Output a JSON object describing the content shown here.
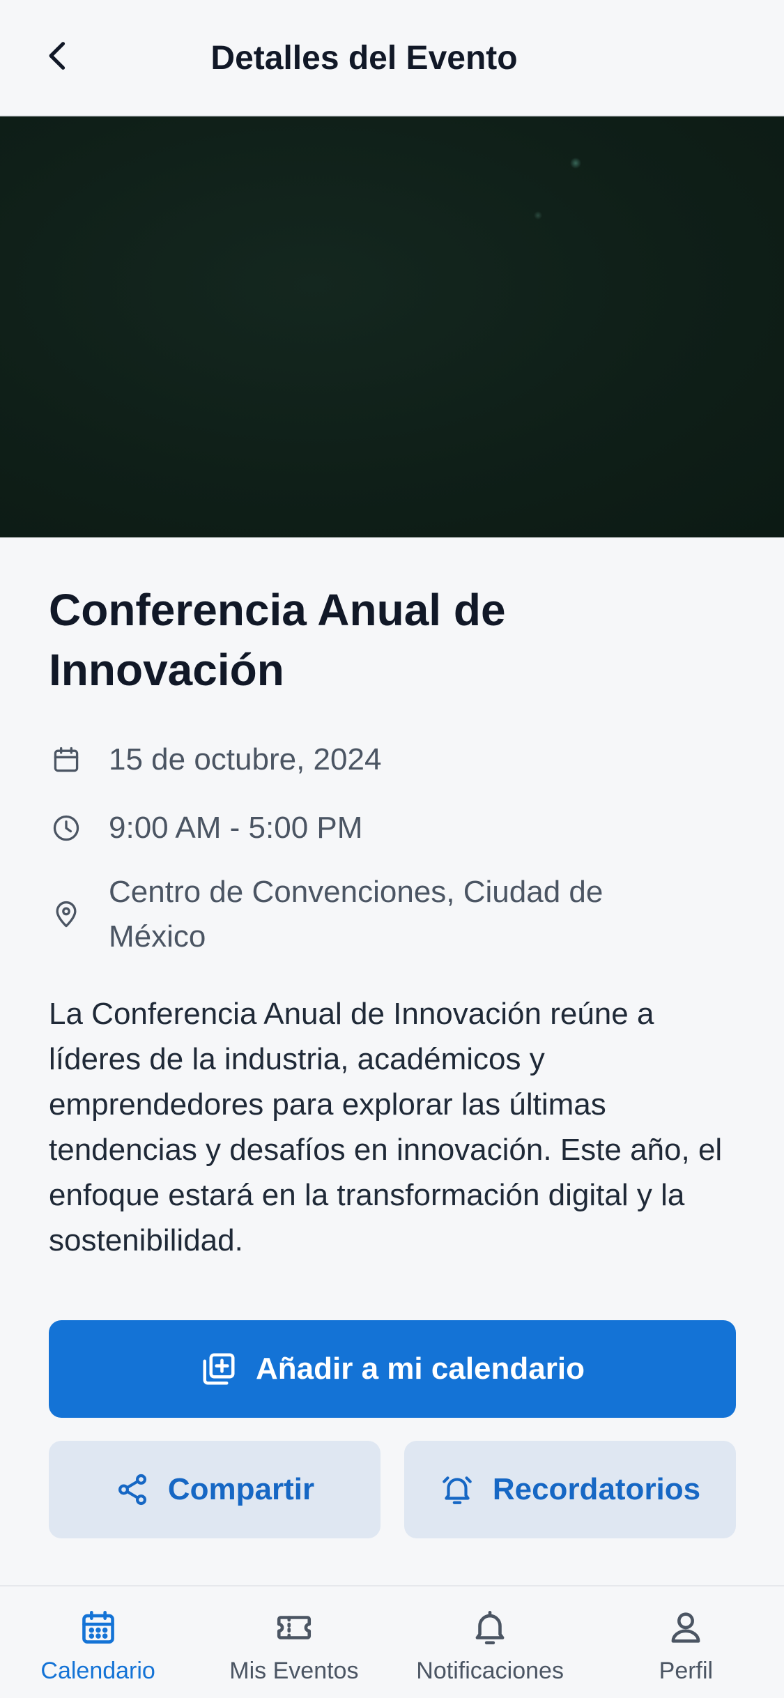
{
  "header": {
    "title": "Detalles del Evento"
  },
  "event": {
    "title": "Conferencia Anual de Innovación",
    "date": "15 de octubre, 2024",
    "time": "9:00 AM - 5:00 PM",
    "location": "Centro de Convenciones, Ciudad de México",
    "description": "La Conferencia Anual de Innovación reúne a líderes de la industria, académicos y emprendedores para explorar las últimas tendencias y desafíos en innovación. Este año, el enfoque estará en la transformación digital y la sostenibilidad."
  },
  "actions": {
    "add_calendar": "Añadir a mi calendario",
    "share": "Compartir",
    "reminders": "Recordatorios"
  },
  "nav": {
    "items": [
      {
        "label": "Calendario",
        "icon": "calendar-icon",
        "active": true
      },
      {
        "label": "Mis Eventos",
        "icon": "ticket-icon",
        "active": false
      },
      {
        "label": "Notificaciones",
        "icon": "bell-icon",
        "active": false
      },
      {
        "label": "Perfil",
        "icon": "person-icon",
        "active": false
      }
    ]
  },
  "colors": {
    "primary": "#1473d6",
    "secondary_bg": "#dfe7f2",
    "background": "#f6f7f9",
    "text": "#111827",
    "muted": "#4b5563"
  }
}
